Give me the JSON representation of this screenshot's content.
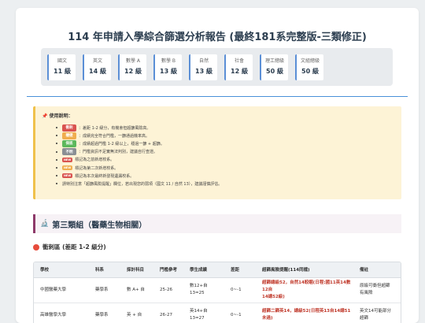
{
  "title": "114 年申請入學綜合篩選分析報告 (最終181系完整版-三類修正)",
  "stats": [
    {
      "label": "國文",
      "value": "11 級"
    },
    {
      "label": "英文",
      "value": "14 級"
    },
    {
      "label": "數學 A",
      "value": "12 級"
    },
    {
      "label": "數學 B",
      "value": "13 級"
    },
    {
      "label": "自然",
      "value": "13 級"
    },
    {
      "label": "社會",
      "value": "12 級"
    },
    {
      "label": "理工總級",
      "value": "50 級"
    },
    {
      "label": "文組總級",
      "value": "50 級"
    }
  ],
  "notice": {
    "title": "使用說明：",
    "items": [
      {
        "tag": "衝刺",
        "color": "#d9534f",
        "text": "：差距 1-2 級分，有機會但超篩風險高。"
      },
      {
        "tag": "穩健",
        "color": "#f0ad4e",
        "text": "：成績完全符合門檻，一篩通過機率高。"
      },
      {
        "tag": "保底",
        "color": "#5cb85c",
        "text": "：成績超過門檻 1-2 級以上，穩過一篩 + 超篩。"
      },
      {
        "tag": "不明",
        "color": "#8a8f94",
        "text": "：門檻資訊不足實無法判別，建議自行查證。"
      },
      {
        "tag": "NEW",
        "color": "#d9534f",
        "text": "標記為之前新增校系。",
        "small": true
      },
      {
        "tag": "NEW",
        "color": "#f0ad4e",
        "text": "標記為第二次新增校系。",
        "small": true
      },
      {
        "tag": "NEW",
        "color": "#d9534f",
        "text": "標記為本次最終新發現遺漏校系。",
        "small": true
      },
      {
        "tag": "",
        "color": "",
        "text": "請特別注意「超篩風險提醒」欄位，若出現您的弱項（國文 11 / 自然 13），建議謹慎評估。"
      }
    ]
  },
  "section": {
    "icon": "microscope-icon",
    "title": "第三類組（醫藥生物相關）"
  },
  "subsection": {
    "title": "衝刺區 (差距 1-2 級分)"
  },
  "table": {
    "headers": [
      "學校",
      "科系",
      "採計科目",
      "門檻參考",
      "學生成績",
      "差距",
      "超篩風險提醒(114同檔)",
      "備註"
    ],
    "rows": [
      {
        "school": "中國醫藥大學",
        "dept": "藥學系",
        "subjects": "數 A+ 自",
        "threshold": "25-26",
        "score_line1": "數12+自",
        "score_line2": "13=25",
        "gap": "0~-1",
        "risk_line1": "超篩總級52，自然14較睏(日程:國11英14數12自",
        "risk_line2": "14總52級)",
        "note_line1": "原級可衝但超篩",
        "note_line2": "有風險"
      },
      {
        "school": "高雄醫學大學",
        "dept": "藥學系",
        "subjects": "英 + 自",
        "threshold": "26-27",
        "score_line1": "英14+自",
        "score_line2": "13=27",
        "gap": "0~-1",
        "risk_line1": "超篩二篩英14，總級52(日程英13自14總51未過)",
        "risk_line2": "",
        "note_line1": "英文14可能部分",
        "note_line2": "超篩"
      }
    ]
  }
}
